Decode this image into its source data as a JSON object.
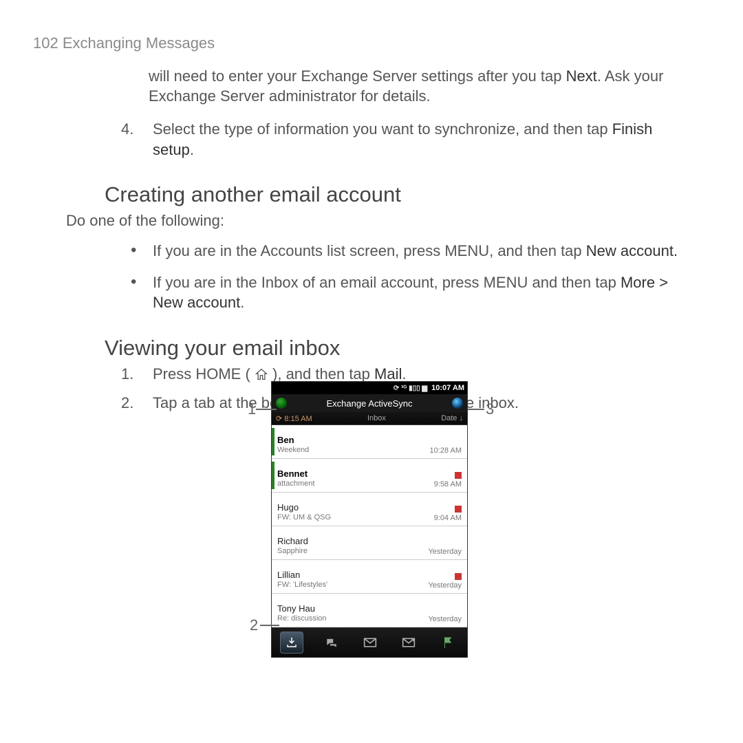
{
  "page_header": "102  Exchanging Messages",
  "para1": "will need to enter your Exchange Server settings after you tap ",
  "para1_next": "Next",
  "para1_b": ". Ask your Exchange Server administrator for details.",
  "step4a": "Select the type of information you want to synchronize, and then tap ",
  "step4_finish": "Finish setup",
  "step4b": ".",
  "h2a": "Creating another email account",
  "lead_a": "Do one of the following:",
  "bul1a": "If you are in the Accounts list screen, press MENU, and then tap ",
  "bul1_new": "New account.",
  "bul2a": "If you are in the Inbox of an email account, press MENU and then tap ",
  "bul2_more": "More > New account",
  "bul2b": ".",
  "h2b": "Viewing your email inbox",
  "v1a": "Press HOME ( ",
  "v1b": " ), and then tap ",
  "v1_mail": "Mail",
  "v1c": ".",
  "v2": "Tap a tab at the bottom of the screen to filter the inbox.",
  "anno": {
    "one": "1",
    "two": "2",
    "three": "3"
  },
  "phone": {
    "time": "10:07 AM",
    "title": "Exchange ActiveSync",
    "sub_clock": "8:15 AM",
    "sub_mid": "Inbox",
    "sub_right": "Date ↓",
    "rows": [
      {
        "sender": "Ben",
        "subject": "Weekend",
        "time": "10:28 AM",
        "unread": true,
        "flag": false
      },
      {
        "sender": "Bennet",
        "subject": "attachment",
        "time": "9:58 AM",
        "unread": true,
        "flag": true
      },
      {
        "sender": "Hugo",
        "subject": "FW: UM & QSG",
        "time": "9:04 AM",
        "unread": false,
        "flag": true
      },
      {
        "sender": "Richard",
        "subject": "Sapphire",
        "time": "Yesterday",
        "unread": false,
        "flag": false
      },
      {
        "sender": "Lillian",
        "subject": "FW: 'Lifestyles'",
        "time": "Yesterday",
        "unread": false,
        "flag": true
      },
      {
        "sender": "Tony Hau",
        "subject": "Re: discussion",
        "time": "Yesterday",
        "unread": false,
        "flag": false
      }
    ]
  }
}
